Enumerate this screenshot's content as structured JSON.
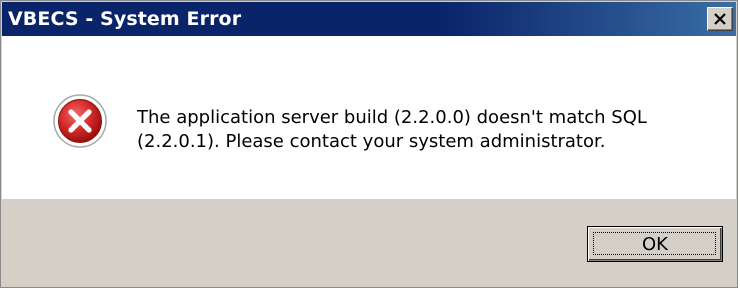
{
  "window": {
    "title": "VBECS - System Error",
    "close_icon": "close-icon"
  },
  "message": {
    "icon": "error-icon",
    "text": "The application server build (2.2.0.0) doesn't match SQL\n(2.2.0.1). Please contact your system administrator."
  },
  "buttons": {
    "ok_label": "OK"
  },
  "colors": {
    "titlebar": "#0a246a",
    "error_red": "#c8102e",
    "face": "#d4d0c8"
  }
}
